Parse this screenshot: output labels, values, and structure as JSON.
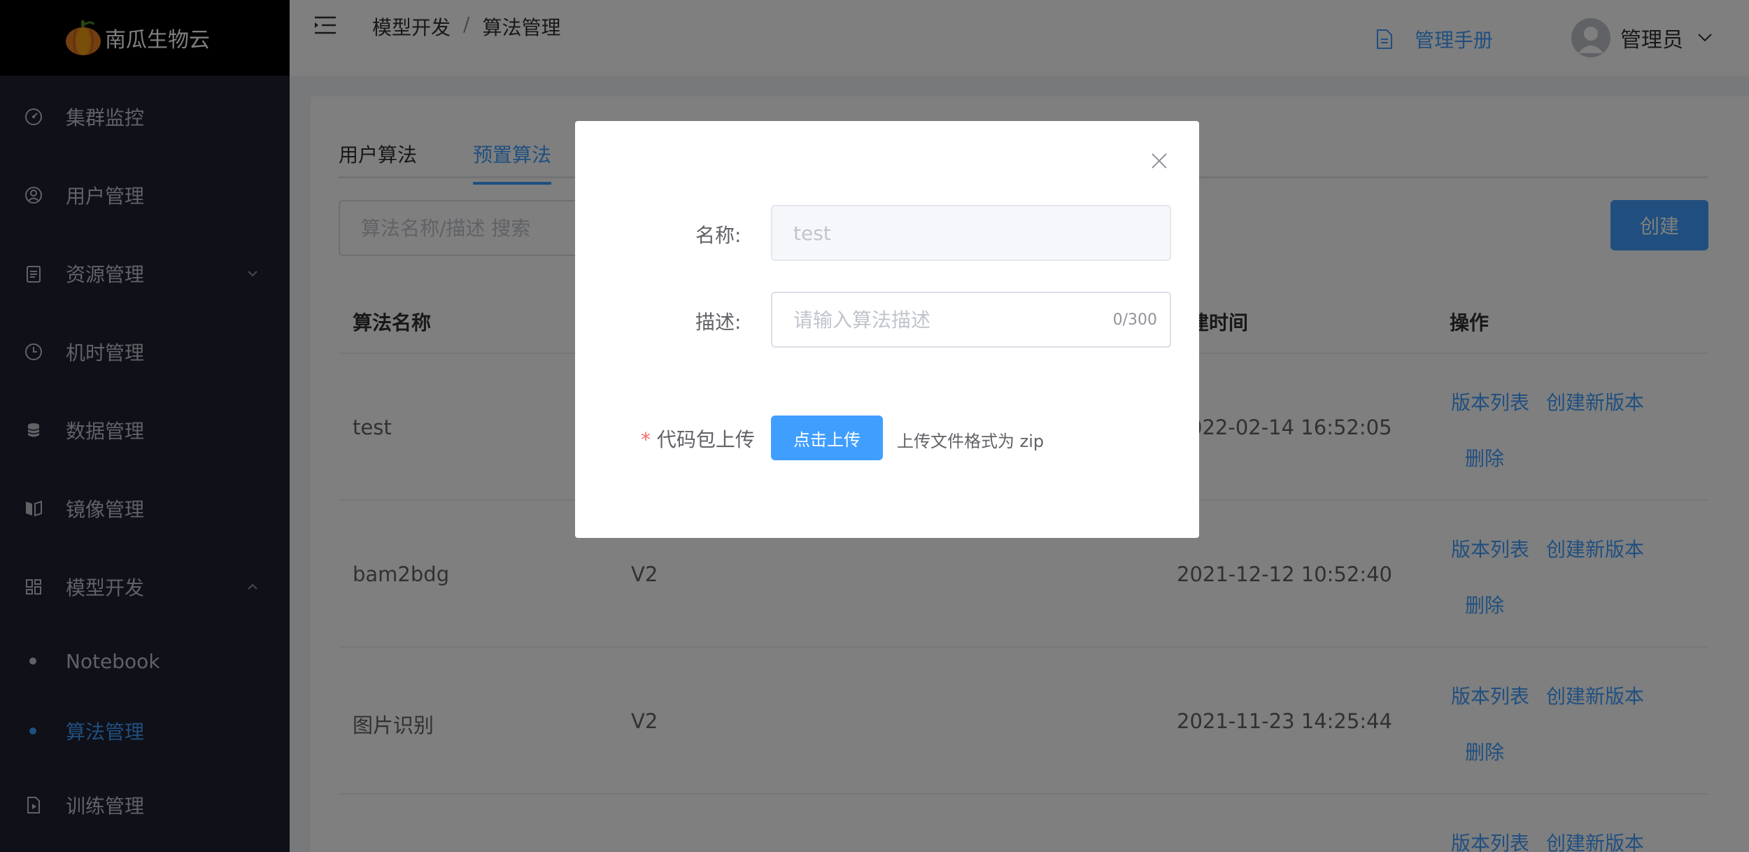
{
  "app": {
    "name": "南瓜生物云"
  },
  "sidebar": {
    "items": [
      {
        "label": "集群监控",
        "icon": "gauge-icon"
      },
      {
        "label": "用户管理",
        "icon": "user-circle-icon"
      },
      {
        "label": "资源管理",
        "icon": "clipboard-icon",
        "expandable": true
      },
      {
        "label": "机时管理",
        "icon": "clock-icon"
      },
      {
        "label": "数据管理",
        "icon": "database-icon"
      },
      {
        "label": "镜像管理",
        "icon": "mirror-icon"
      },
      {
        "label": "模型开发",
        "icon": "grid-icon",
        "expanded": true
      },
      {
        "label": "训练管理",
        "icon": "doc-play-icon"
      }
    ],
    "sub_items": [
      {
        "label": "Notebook"
      },
      {
        "label": "算法管理",
        "active": true
      }
    ]
  },
  "header": {
    "breadcrumb": [
      "模型开发",
      "算法管理"
    ],
    "breadcrumb_sep": "/",
    "manual": "管理手册",
    "user": "管理员"
  },
  "main": {
    "tabs": [
      {
        "label": "用户算法"
      },
      {
        "label": "预置算法",
        "active": true
      }
    ],
    "search": {
      "placeholder": "算法名称/描述 搜索"
    },
    "create_label": "创建",
    "table": {
      "headers": {
        "name": "算法名称",
        "created": "建时间",
        "ops": "操作"
      },
      "rows": [
        {
          "name": "test",
          "version": "",
          "created": "022-02-14 16:52:05"
        },
        {
          "name": "bam2bdg",
          "version": "V2",
          "created": "2021-12-12 10:52:40"
        },
        {
          "name": "图片识别",
          "version": "V2",
          "created": "2021-11-23 14:25:44"
        }
      ],
      "ops": {
        "versions": "版本列表",
        "new_version": "创建新版本",
        "delete": "删除"
      }
    }
  },
  "dialog": {
    "name_label": "名称:",
    "name_value": "test",
    "desc_label": "描述:",
    "desc_placeholder": "请输入算法描述",
    "desc_counter": "0/300",
    "upload_required": "*",
    "upload_label": "代码包上传",
    "upload_button": "点击上传",
    "upload_tip": "上传文件格式为 zip"
  },
  "colors": {
    "accent": "#409eff",
    "sidebar": "#1f2130",
    "required": "#f56c6c"
  }
}
